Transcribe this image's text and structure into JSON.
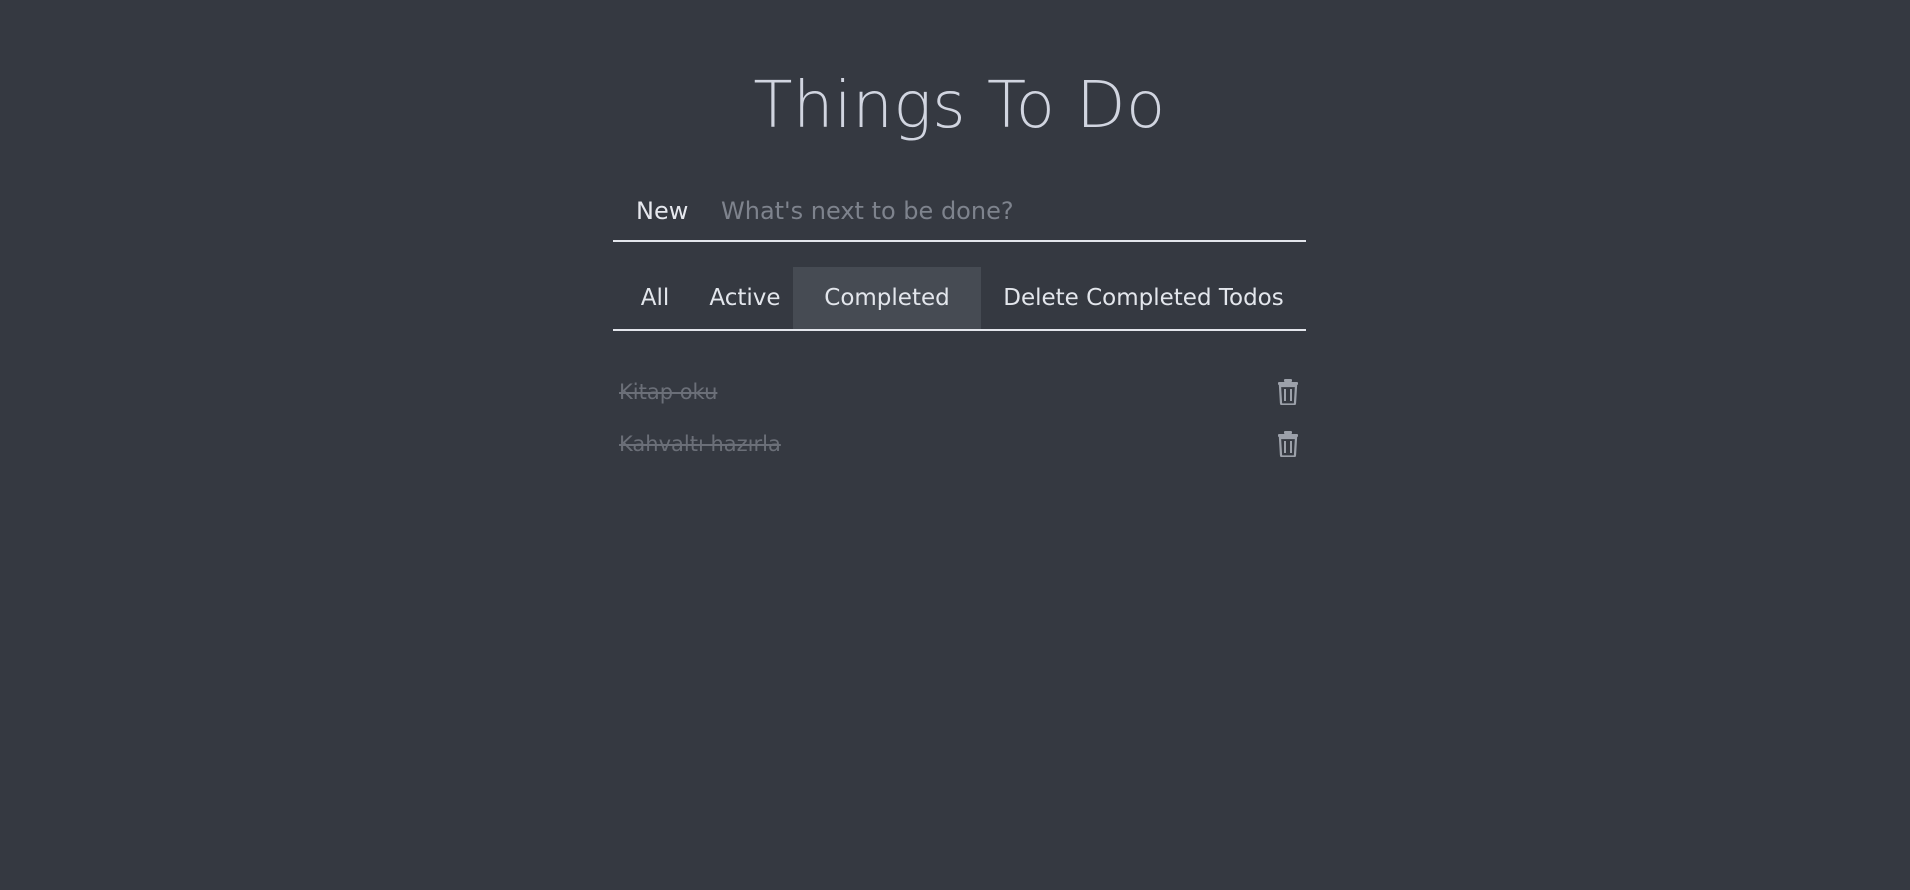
{
  "header": {
    "title": "Things To Do"
  },
  "new_todo": {
    "label": "New",
    "placeholder": "What's next to be done?",
    "value": ""
  },
  "filters": {
    "all": "All",
    "active": "Active",
    "completed": "Completed",
    "delete_completed": "Delete Completed Todos",
    "selected": "Completed"
  },
  "todos": [
    {
      "text": "Kitap oku",
      "completed": true,
      "action_icon": "trash-icon"
    },
    {
      "text": "Kahvaltı hazırla",
      "completed": true,
      "action_icon": "trash-icon"
    }
  ],
  "colors": {
    "background": "#353941",
    "selected_filter_bg": "#464b53",
    "completed_text": "#6b6f78"
  }
}
